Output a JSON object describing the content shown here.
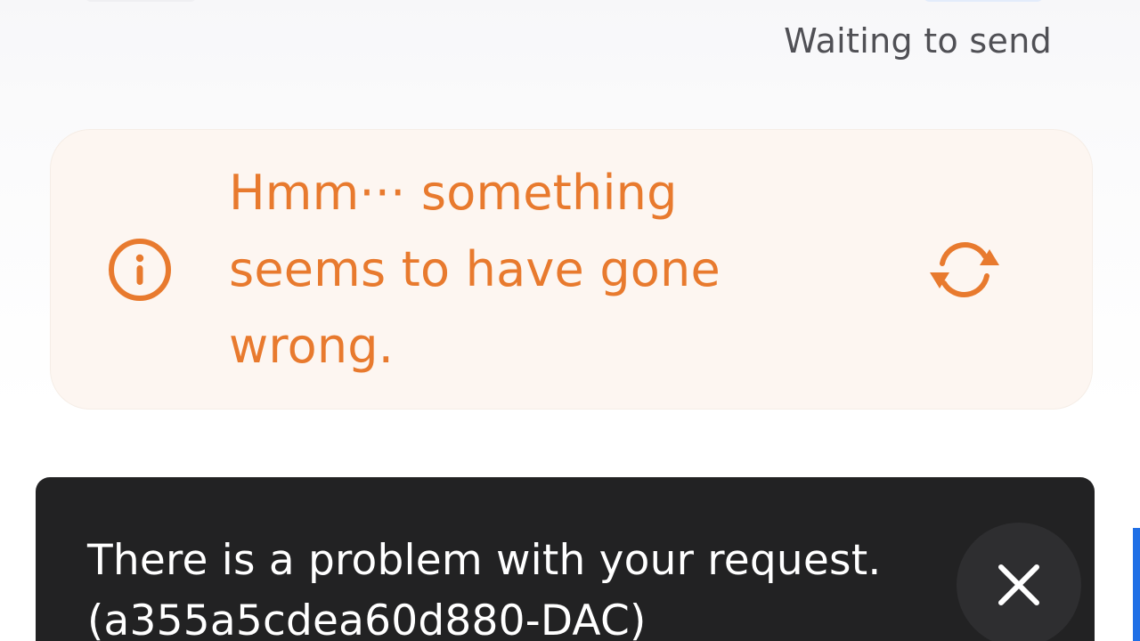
{
  "header": {
    "status_text": "Waiting to send"
  },
  "error_card": {
    "message": "Hmm··· something seems to have gone wrong.",
    "accent_color": "#e87a2e",
    "info_icon": "info-circle-icon",
    "retry_icon": "refresh-icon"
  },
  "toast": {
    "message_line1": "There is a problem with your request.",
    "message_line2": "(a355a5cdea60d880-DAC)",
    "close_icon": "close-icon"
  }
}
